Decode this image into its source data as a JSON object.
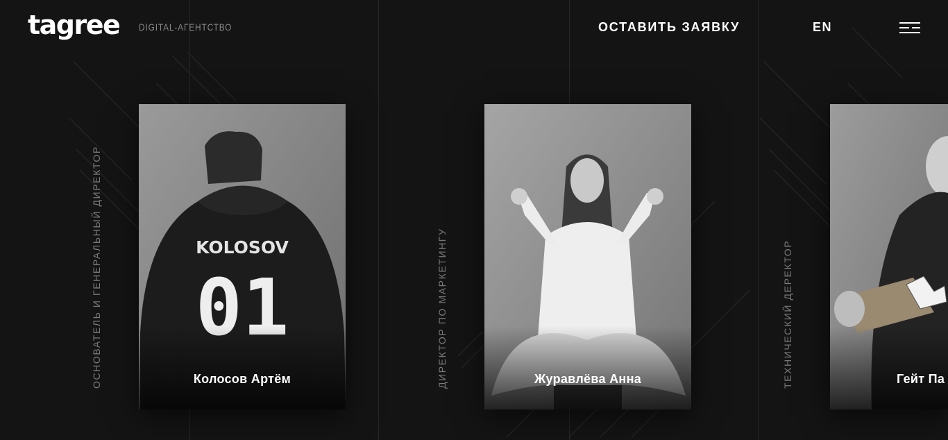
{
  "header": {
    "logo": "tagree",
    "tagline": "DIGITAL-АГЕНТСТВО",
    "cta_label": "ОСТАВИТЬ ЗАЯВКУ",
    "lang_label": "EN",
    "menu_icon": "hamburger-icon"
  },
  "team": [
    {
      "role": "ОСНОВАТЕЛЬ И ГЕНЕРАЛЬНЫЙ ДИРЕКТОР",
      "name": "Колосов Артём",
      "shirt_name": "KOLOSOV",
      "shirt_number": "01"
    },
    {
      "role": "ДИРЕКТОР ПО МАРКЕТИНГУ",
      "name": "Журавлёва Анна"
    },
    {
      "role": "ТЕХНИЧЕСКИЙ ДЕРЕКТОР",
      "name": "Гейт Па"
    }
  ],
  "colors": {
    "background": "#141414",
    "text": "#ffffff",
    "muted": "#8a8a8a"
  }
}
